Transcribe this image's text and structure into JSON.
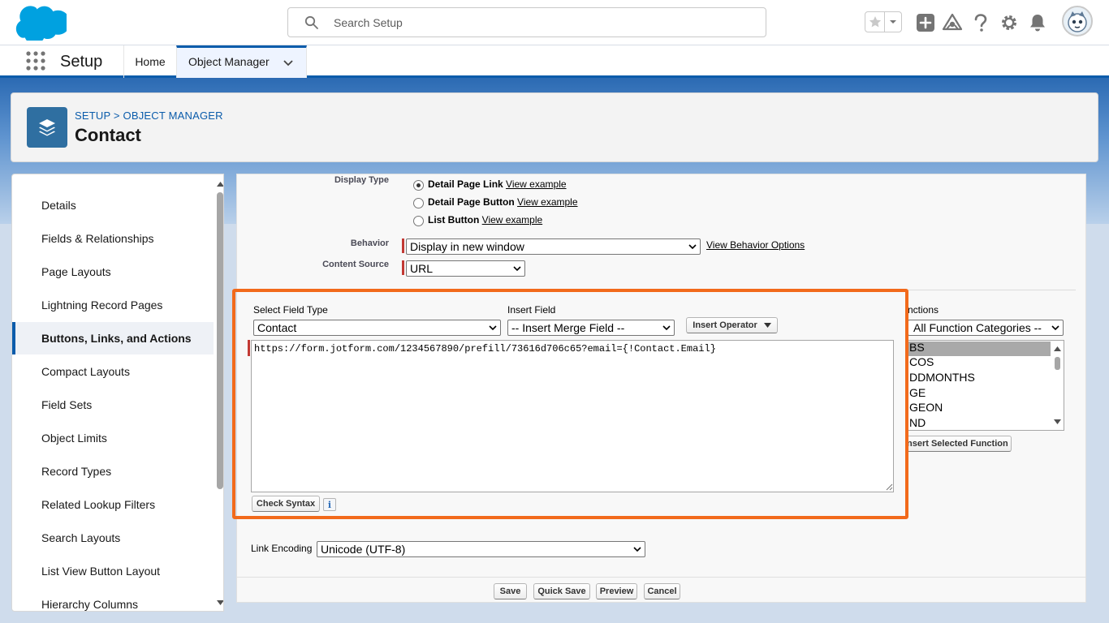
{
  "header": {
    "search_placeholder": "Search Setup"
  },
  "context": {
    "app_name": "Setup",
    "tabs": [
      "Home",
      "Object Manager"
    ]
  },
  "page_header": {
    "breadcrumb": "SETUP > OBJECT MANAGER",
    "title": "Contact"
  },
  "sidebar": {
    "items": [
      {
        "label": "Details",
        "active": false
      },
      {
        "label": "Fields & Relationships",
        "active": false
      },
      {
        "label": "Page Layouts",
        "active": false
      },
      {
        "label": "Lightning Record Pages",
        "active": false
      },
      {
        "label": "Buttons, Links, and Actions",
        "active": true
      },
      {
        "label": "Compact Layouts",
        "active": false
      },
      {
        "label": "Field Sets",
        "active": false
      },
      {
        "label": "Object Limits",
        "active": false
      },
      {
        "label": "Record Types",
        "active": false
      },
      {
        "label": "Related Lookup Filters",
        "active": false
      },
      {
        "label": "Search Layouts",
        "active": false
      },
      {
        "label": "List View Button Layout",
        "active": false
      },
      {
        "label": "Hierarchy Columns",
        "active": false
      }
    ]
  },
  "form": {
    "display_type_label": "Display Type",
    "display_options": [
      {
        "label": "Detail Page Link",
        "link": "View example",
        "checked": true
      },
      {
        "label": "Detail Page Button",
        "link": "View example",
        "checked": false
      },
      {
        "label": "List Button",
        "link": "View example",
        "checked": false
      }
    ],
    "behavior_label": "Behavior",
    "behavior_value": "Display in new window",
    "behavior_link": "View Behavior Options",
    "content_source_label": "Content Source",
    "content_source_value": "URL",
    "field_type_label": "Select Field Type",
    "field_type_value": "Contact",
    "insert_field_label": "Insert Field",
    "insert_field_value": "-- Insert Merge Field --",
    "insert_operator": "Insert Operator",
    "functions_label": "nctions",
    "functions_category": "All Function Categories --",
    "function_items": [
      "BS",
      "COS",
      "DDMONTHS",
      "GE",
      "GEON",
      "ND"
    ],
    "insert_function": "nsert Selected Function",
    "formula": "https://form.jotform.com/1234567890/prefill/73616d706c65?email={!Contact.Email}",
    "check_syntax": "Check Syntax",
    "info": "i",
    "link_encoding_label": "Link Encoding",
    "link_encoding_value": "Unicode (UTF-8)"
  },
  "actions": {
    "save": "Save",
    "quick_save": "Quick Save",
    "preview": "Preview",
    "cancel": "Cancel"
  },
  "colors": {
    "brand_blue": "#0b5cab",
    "highlight": "#f26a1b",
    "required": "#c23934"
  }
}
